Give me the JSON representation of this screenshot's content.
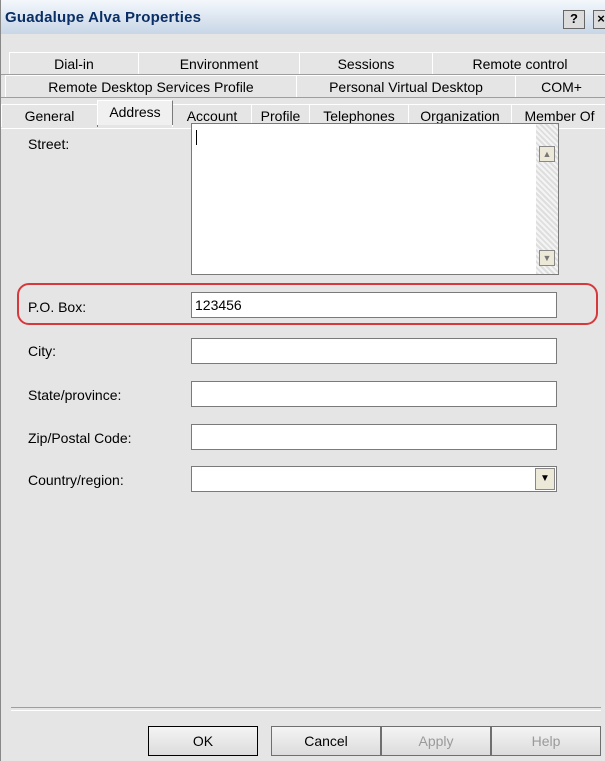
{
  "window": {
    "title": "Guadalupe Alva Properties",
    "help_glyph": "?",
    "close_glyph": "×"
  },
  "tabs": {
    "row1": [
      "Dial-in",
      "Environment",
      "Sessions",
      "Remote control"
    ],
    "row2": [
      "Remote Desktop Services Profile",
      "Personal Virtual Desktop",
      "COM+"
    ],
    "row3": [
      "General",
      "Address",
      "Account",
      "Profile",
      "Telephones",
      "Organization",
      "Member Of"
    ],
    "active": "Address"
  },
  "form": {
    "street_label": "Street:",
    "street_value": "",
    "po_box_label": "P.O. Box:",
    "po_box_value": "123456",
    "city_label": "City:",
    "city_value": "",
    "state_label": "State/province:",
    "state_value": "",
    "zip_label": "Zip/Postal Code:",
    "zip_value": "",
    "country_label": "Country/region:",
    "country_value": ""
  },
  "buttons": {
    "ok": "OK",
    "cancel": "Cancel",
    "apply": "Apply",
    "help": "Help"
  },
  "icons": {
    "scroll_up": "▲",
    "scroll_down": "▼",
    "dropdown": "▼"
  },
  "colors": {
    "highlight": "#d6383c",
    "title_text": "#0a2f66"
  }
}
